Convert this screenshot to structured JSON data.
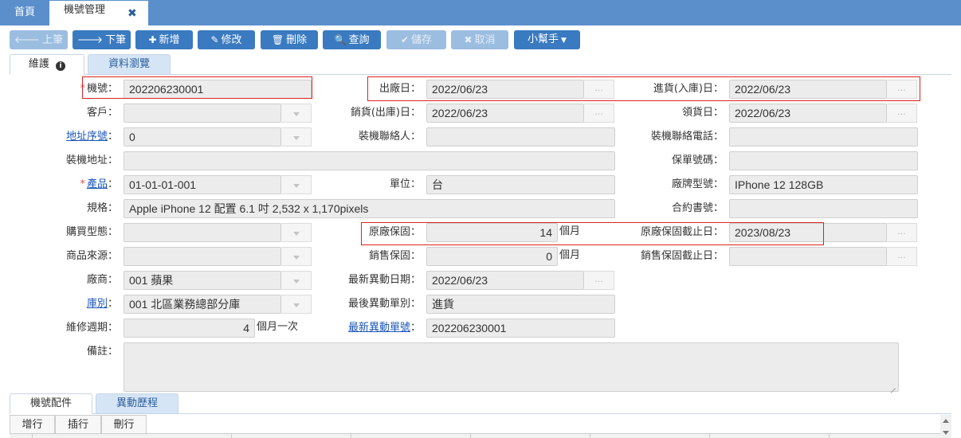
{
  "top_tabs": {
    "home": "首頁",
    "active": "機號管理",
    "close": "✖"
  },
  "toolbar": {
    "prev": "上筆",
    "next": "下筆",
    "add": "新增",
    "edit": "修改",
    "delete": "刪除",
    "query": "查詢",
    "save": "儲存",
    "cancel": "取消",
    "helper": "小幫手"
  },
  "subtabs": {
    "maintain": "維護",
    "browse": "資料瀏覽"
  },
  "form": {
    "machine_no": {
      "label": "機號：",
      "value": "202206230001"
    },
    "customer": {
      "label": "客戶：",
      "value": ""
    },
    "addr_seq": {
      "label": "地址序號",
      "colon": "：",
      "value": "0"
    },
    "install_addr": {
      "label": "裝機地址：",
      "value": ""
    },
    "product": {
      "label": "產品",
      "colon": "：",
      "value": "01-01-01-001"
    },
    "spec": {
      "label": "規格：",
      "value": "Apple iPhone 12 配置 6.1 吋 2,532 x 1,170pixels"
    },
    "purchase_type": {
      "label": "購買型態：",
      "value": ""
    },
    "product_source": {
      "label": "商品來源：",
      "value": ""
    },
    "vendor": {
      "label": "廠商：",
      "value": "001 蘋果"
    },
    "warehouse": {
      "label": "庫別",
      "colon": "：",
      "value": "001 北區業務總部分庫"
    },
    "maint_cycle": {
      "label": "維修週期：",
      "value": "4",
      "unit": "個月一次"
    },
    "remark": {
      "label": "備註：",
      "value": ""
    },
    "ship_date": {
      "label": "出廠日：",
      "value": "2022/06/23"
    },
    "sales_date": {
      "label": "銷貨(出庫)日：",
      "value": "2022/06/23"
    },
    "install_contact": {
      "label": "裝機聯絡人：",
      "value": ""
    },
    "unit": {
      "label": "單位：",
      "value": "台"
    },
    "factory_warranty": {
      "label": "原廠保固：",
      "value": "14",
      "unit": "個月"
    },
    "sales_warranty": {
      "label": "銷售保固：",
      "value": "0",
      "unit": "個月"
    },
    "latest_change_date": {
      "label": "最新異動日期：",
      "value": "2022/06/23"
    },
    "last_change_type": {
      "label": "最後異動單別：",
      "value": "進貨"
    },
    "latest_change_no": {
      "label": "最新異動單號",
      "colon": "：",
      "value": "202206230001"
    },
    "stock_in_date": {
      "label": "進貨(入庫)日：",
      "value": "2022/06/23"
    },
    "receive_date": {
      "label": "領貨日：",
      "value": "2022/06/23"
    },
    "install_phone": {
      "label": "裝機聯絡電話：",
      "value": ""
    },
    "warranty_no": {
      "label": "保單號碼：",
      "value": ""
    },
    "brand_model": {
      "label": "廠牌型號：",
      "value": "IPhone 12 128GB"
    },
    "contract_no": {
      "label": "合約書號：",
      "value": ""
    },
    "factory_warranty_end": {
      "label": "原廠保固截止日：",
      "value": "2023/08/23"
    },
    "sales_warranty_end": {
      "label": "銷售保固截止日：",
      "value": ""
    },
    "dots": "..."
  },
  "bottom_tabs": {
    "parts": "機號配件",
    "history": "異動歷程"
  },
  "grid_toolbar": {
    "add_row": "增行",
    "insert_row": "插行",
    "delete_row": "刪行"
  }
}
